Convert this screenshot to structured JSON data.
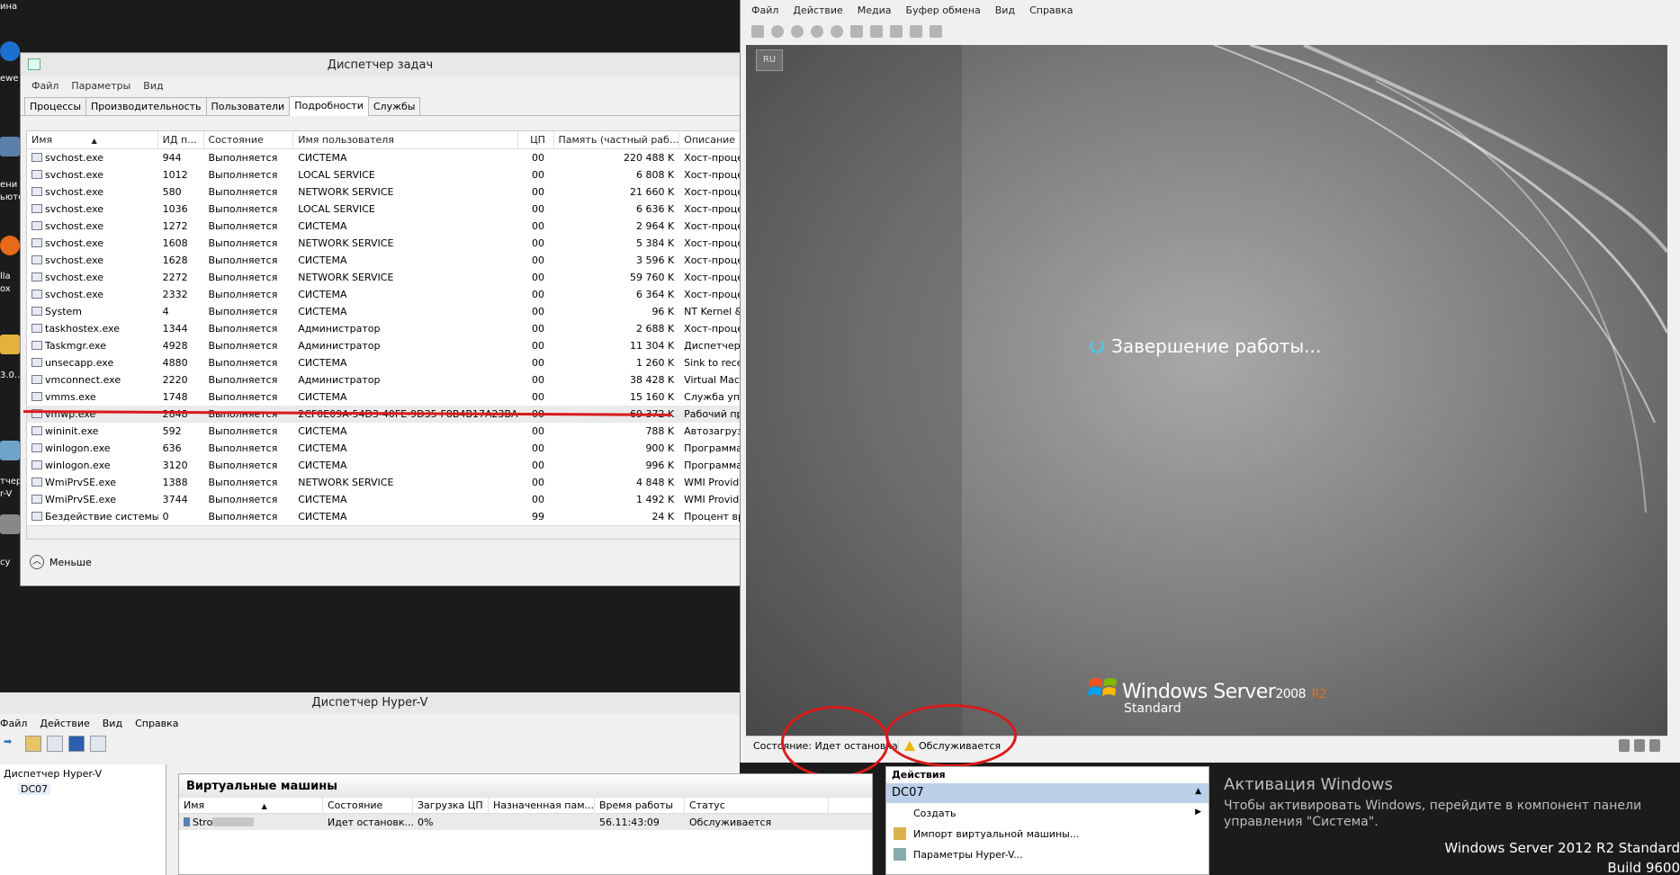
{
  "desktop": {
    "labels": [
      "ина",
      "ewe",
      "ени",
      "ьюте",
      "lla",
      "ox",
      "3.0...",
      "тчер",
      "r-V",
      "cy"
    ]
  },
  "task_manager": {
    "title": "Диспетчер задач",
    "menu": [
      "Файл",
      "Параметры",
      "Вид"
    ],
    "tabs": [
      "Процессы",
      "Производительность",
      "Пользователи",
      "Подробности",
      "Службы"
    ],
    "active_tab": "Подробности",
    "columns": [
      "Имя",
      "ИД п...",
      "Состояние",
      "Имя пользователя",
      "ЦП",
      "Память (частный раб...",
      "Описание"
    ],
    "rows": [
      [
        "svchost.exe",
        "944",
        "Выполняется",
        "СИСТЕМА",
        "00",
        "220 488 K",
        "Хост-процесс"
      ],
      [
        "svchost.exe",
        "1012",
        "Выполняется",
        "LOCAL SERVICE",
        "00",
        "6 808 K",
        "Хост-процесс"
      ],
      [
        "svchost.exe",
        "580",
        "Выполняется",
        "NETWORK SERVICE",
        "00",
        "21 660 K",
        "Хост-процесс"
      ],
      [
        "svchost.exe",
        "1036",
        "Выполняется",
        "LOCAL SERVICE",
        "00",
        "6 636 K",
        "Хост-процесс"
      ],
      [
        "svchost.exe",
        "1272",
        "Выполняется",
        "СИСТЕМА",
        "00",
        "2 964 K",
        "Хост-процесс"
      ],
      [
        "svchost.exe",
        "1608",
        "Выполняется",
        "NETWORK SERVICE",
        "00",
        "5 384 K",
        "Хост-процесс"
      ],
      [
        "svchost.exe",
        "1628",
        "Выполняется",
        "СИСТЕМА",
        "00",
        "3 596 K",
        "Хост-процесс"
      ],
      [
        "svchost.exe",
        "2272",
        "Выполняется",
        "NETWORK SERVICE",
        "00",
        "59 760 K",
        "Хост-процесс"
      ],
      [
        "svchost.exe",
        "2332",
        "Выполняется",
        "СИСТЕМА",
        "00",
        "6 364 K",
        "Хост-процесс"
      ],
      [
        "System",
        "4",
        "Выполняется",
        "СИСТЕМА",
        "00",
        "96 K",
        "NT Kernel & S"
      ],
      [
        "taskhostex.exe",
        "1344",
        "Выполняется",
        "Администратор",
        "00",
        "2 688 K",
        "Хост-процесс"
      ],
      [
        "Taskmgr.exe",
        "4928",
        "Выполняется",
        "Администратор",
        "00",
        "11 304 K",
        "Диспетчер за"
      ],
      [
        "unsecapp.exe",
        "4880",
        "Выполняется",
        "СИСТЕМА",
        "00",
        "1 260 K",
        "Sink to receiv"
      ],
      [
        "vmconnect.exe",
        "2220",
        "Выполняется",
        "Администратор",
        "00",
        "38 428 K",
        "Virtual Machi"
      ],
      [
        "vmms.exe",
        "1748",
        "Выполняется",
        "СИСТЕМА",
        "00",
        "15 160 K",
        "Служба упра"
      ],
      [
        "vmwp.exe",
        "2848",
        "Выполняется",
        "2CF0E09A-54D3-40FE-9D35-F8B4B17A23BA",
        "00",
        "69 372 K",
        "Рабочий про"
      ],
      [
        "wininit.exe",
        "592",
        "Выполняется",
        "СИСТЕМА",
        "00",
        "788 K",
        "Автозагрузка"
      ],
      [
        "winlogon.exe",
        "636",
        "Выполняется",
        "СИСТЕМА",
        "00",
        "900 K",
        "Программа в"
      ],
      [
        "winlogon.exe",
        "3120",
        "Выполняется",
        "СИСТЕМА",
        "00",
        "996 K",
        "Программа в"
      ],
      [
        "WmiPrvSE.exe",
        "1388",
        "Выполняется",
        "NETWORK SERVICE",
        "00",
        "4 848 K",
        "WMI Provider"
      ],
      [
        "WmiPrvSE.exe",
        "3744",
        "Выполняется",
        "СИСТЕМА",
        "00",
        "1 492 K",
        "WMI Provider"
      ],
      [
        "Бездействие системы",
        "0",
        "Выполняется",
        "СИСТЕМА",
        "99",
        "24 K",
        "Процент врем"
      ]
    ],
    "selected_row": 15,
    "less_label": "Меньше"
  },
  "vm_connection": {
    "menu": [
      "Файл",
      "Действие",
      "Медиа",
      "Буфер обмена",
      "Вид",
      "Справка"
    ],
    "lang": "RU",
    "message": "Завершение работы...",
    "logo_name": "Windows Server",
    "logo_year": "2008",
    "logo_r2": "R2",
    "logo_edition": "Standard",
    "status_state": "Состояние: Идет остановка",
    "status_service": "Обслуживается"
  },
  "hyperv": {
    "title": "Диспетчер Hyper-V",
    "menu": [
      "Файл",
      "Действие",
      "Вид",
      "Справка"
    ],
    "tree_root": "Диспетчер Hyper-V",
    "tree_node": "DC07",
    "vms_header": "Виртуальные машины",
    "vm_columns": [
      "Имя",
      "Состояние",
      "Загрузка ЦП",
      "Назначенная пам...",
      "Время работы",
      "Статус"
    ],
    "vm_row": {
      "name": "Stro",
      "state": "Идет остановк...",
      "cpu": "0%",
      "mem": "",
      "uptime": "56.11:43:09",
      "status": "Обслуживается"
    },
    "actions_header": "Действия",
    "actions_selected": "DC07",
    "actions": [
      "Создать",
      "Импорт виртуальной машины...",
      "Параметры Hyper-V..."
    ]
  },
  "activation": {
    "title": "Активация Windows",
    "text": "Чтобы активировать Windows, перейдите в компонент панели управления \"Система\"."
  },
  "os_build": {
    "line1": "Windows Server 2012 R2 Standard",
    "line2": "Build 9600"
  },
  "colors": {
    "annotation_red": "#d91a1a",
    "desktop_bg": "#1b1b1b",
    "spinner": "#5bc0de"
  }
}
